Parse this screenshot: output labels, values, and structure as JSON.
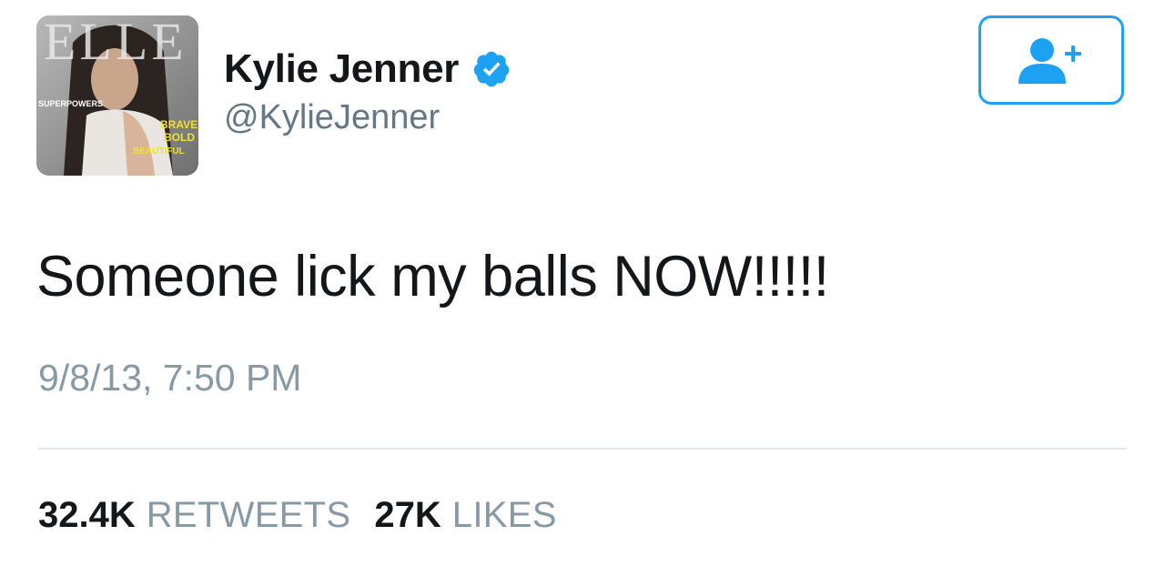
{
  "colors": {
    "accent": "#1da1f2",
    "verified": "#1da1f2",
    "text": "#14171a",
    "secondary": "#8899a6",
    "handle": "#657786",
    "divider": "#e1e8ed"
  },
  "profile": {
    "avatar_icon": "magazine-cover-avatar",
    "avatar_text": {
      "masthead": "ELLE",
      "cover_line_1": "SUPERPOWERS",
      "cover_line_2": "BRAVE",
      "cover_line_3": "BOLD",
      "cover_line_4": "BEAUTIFUL"
    },
    "display_name": "Kylie Jenner",
    "verified_icon": "verified-badge-icon",
    "handle": "@KylieJenner"
  },
  "follow_button": {
    "icon": "follow-user-plus-icon"
  },
  "tweet": {
    "text": "Someone lick my balls NOW!!!!!",
    "timestamp": "9/8/13, 7:50 PM"
  },
  "stats": {
    "retweets_count": "32.4K",
    "retweets_label": "RETWEETS",
    "likes_count": "27K",
    "likes_label": "LIKES"
  }
}
